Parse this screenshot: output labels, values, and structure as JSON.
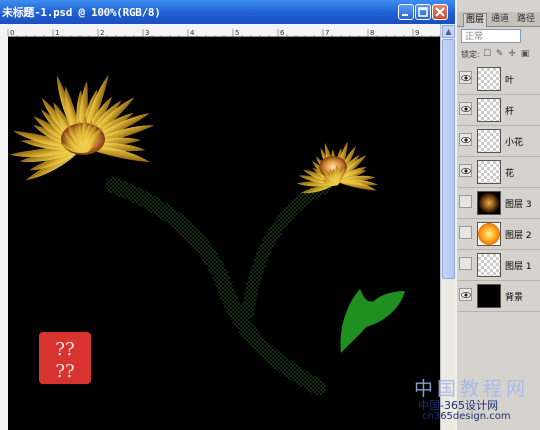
{
  "document": {
    "title": "未标题-1.psd @ 100%(RGB/8)",
    "ruler_numbers": [
      "0",
      "1",
      "2",
      "3",
      "4",
      "5",
      "6",
      "7",
      "8",
      "9",
      "10",
      "11"
    ]
  },
  "layers_panel": {
    "tabs": [
      "图层",
      "通道",
      "路径"
    ],
    "blend_mode": "正常",
    "lock_label": "锁定:",
    "layers": [
      {
        "name": "叶",
        "visible": true,
        "thumb": "transparent"
      },
      {
        "name": "杆",
        "visible": true,
        "thumb": "transparent"
      },
      {
        "name": "小花",
        "visible": true,
        "thumb": "transparent"
      },
      {
        "name": "花",
        "visible": true,
        "thumb": "transparent"
      },
      {
        "name": "图层 3",
        "visible": false,
        "thumb": "dark-flower"
      },
      {
        "name": "图层 2",
        "visible": false,
        "thumb": "orange-flower"
      },
      {
        "name": "图层 1",
        "visible": false,
        "thumb": "transparent"
      },
      {
        "name": "背景",
        "visible": true,
        "thumb": "black"
      }
    ]
  },
  "watermark": {
    "line1": "中国教程网",
    "line2": "中国-365设计网",
    "line3": "cn365design.com"
  },
  "colors": {
    "titlebar": "#1f5fd3",
    "canvas": "#000000",
    "leaf": "#1f8f1f",
    "petal_yellow": "#f2c94c",
    "seal_red": "#d8342f"
  }
}
